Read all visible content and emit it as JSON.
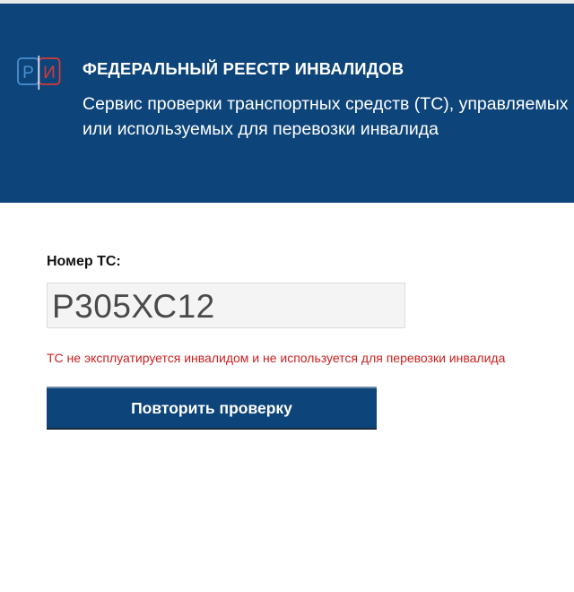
{
  "header": {
    "logo_letters": "РИ",
    "title": "ФЕДЕРАЛЬНЫЙ РЕЕСТР ИНВАЛИДОВ",
    "subtitle": "Сервис проверки транспортных средств (ТС), управляемых\nили используемых для перевозки инвалида",
    "background_color": "#0d4479"
  },
  "form": {
    "vehicle_number_label": "Номер ТС:",
    "vehicle_number_value": "Р305ХС12"
  },
  "result": {
    "message": "ТС не эксплуатируется инвалидом и не используется для перевозки инвалида",
    "message_color": "#cc1f1f"
  },
  "actions": {
    "retry_label": "Повторить проверку"
  },
  "icons": {
    "logo": "registry-logo-icon"
  }
}
